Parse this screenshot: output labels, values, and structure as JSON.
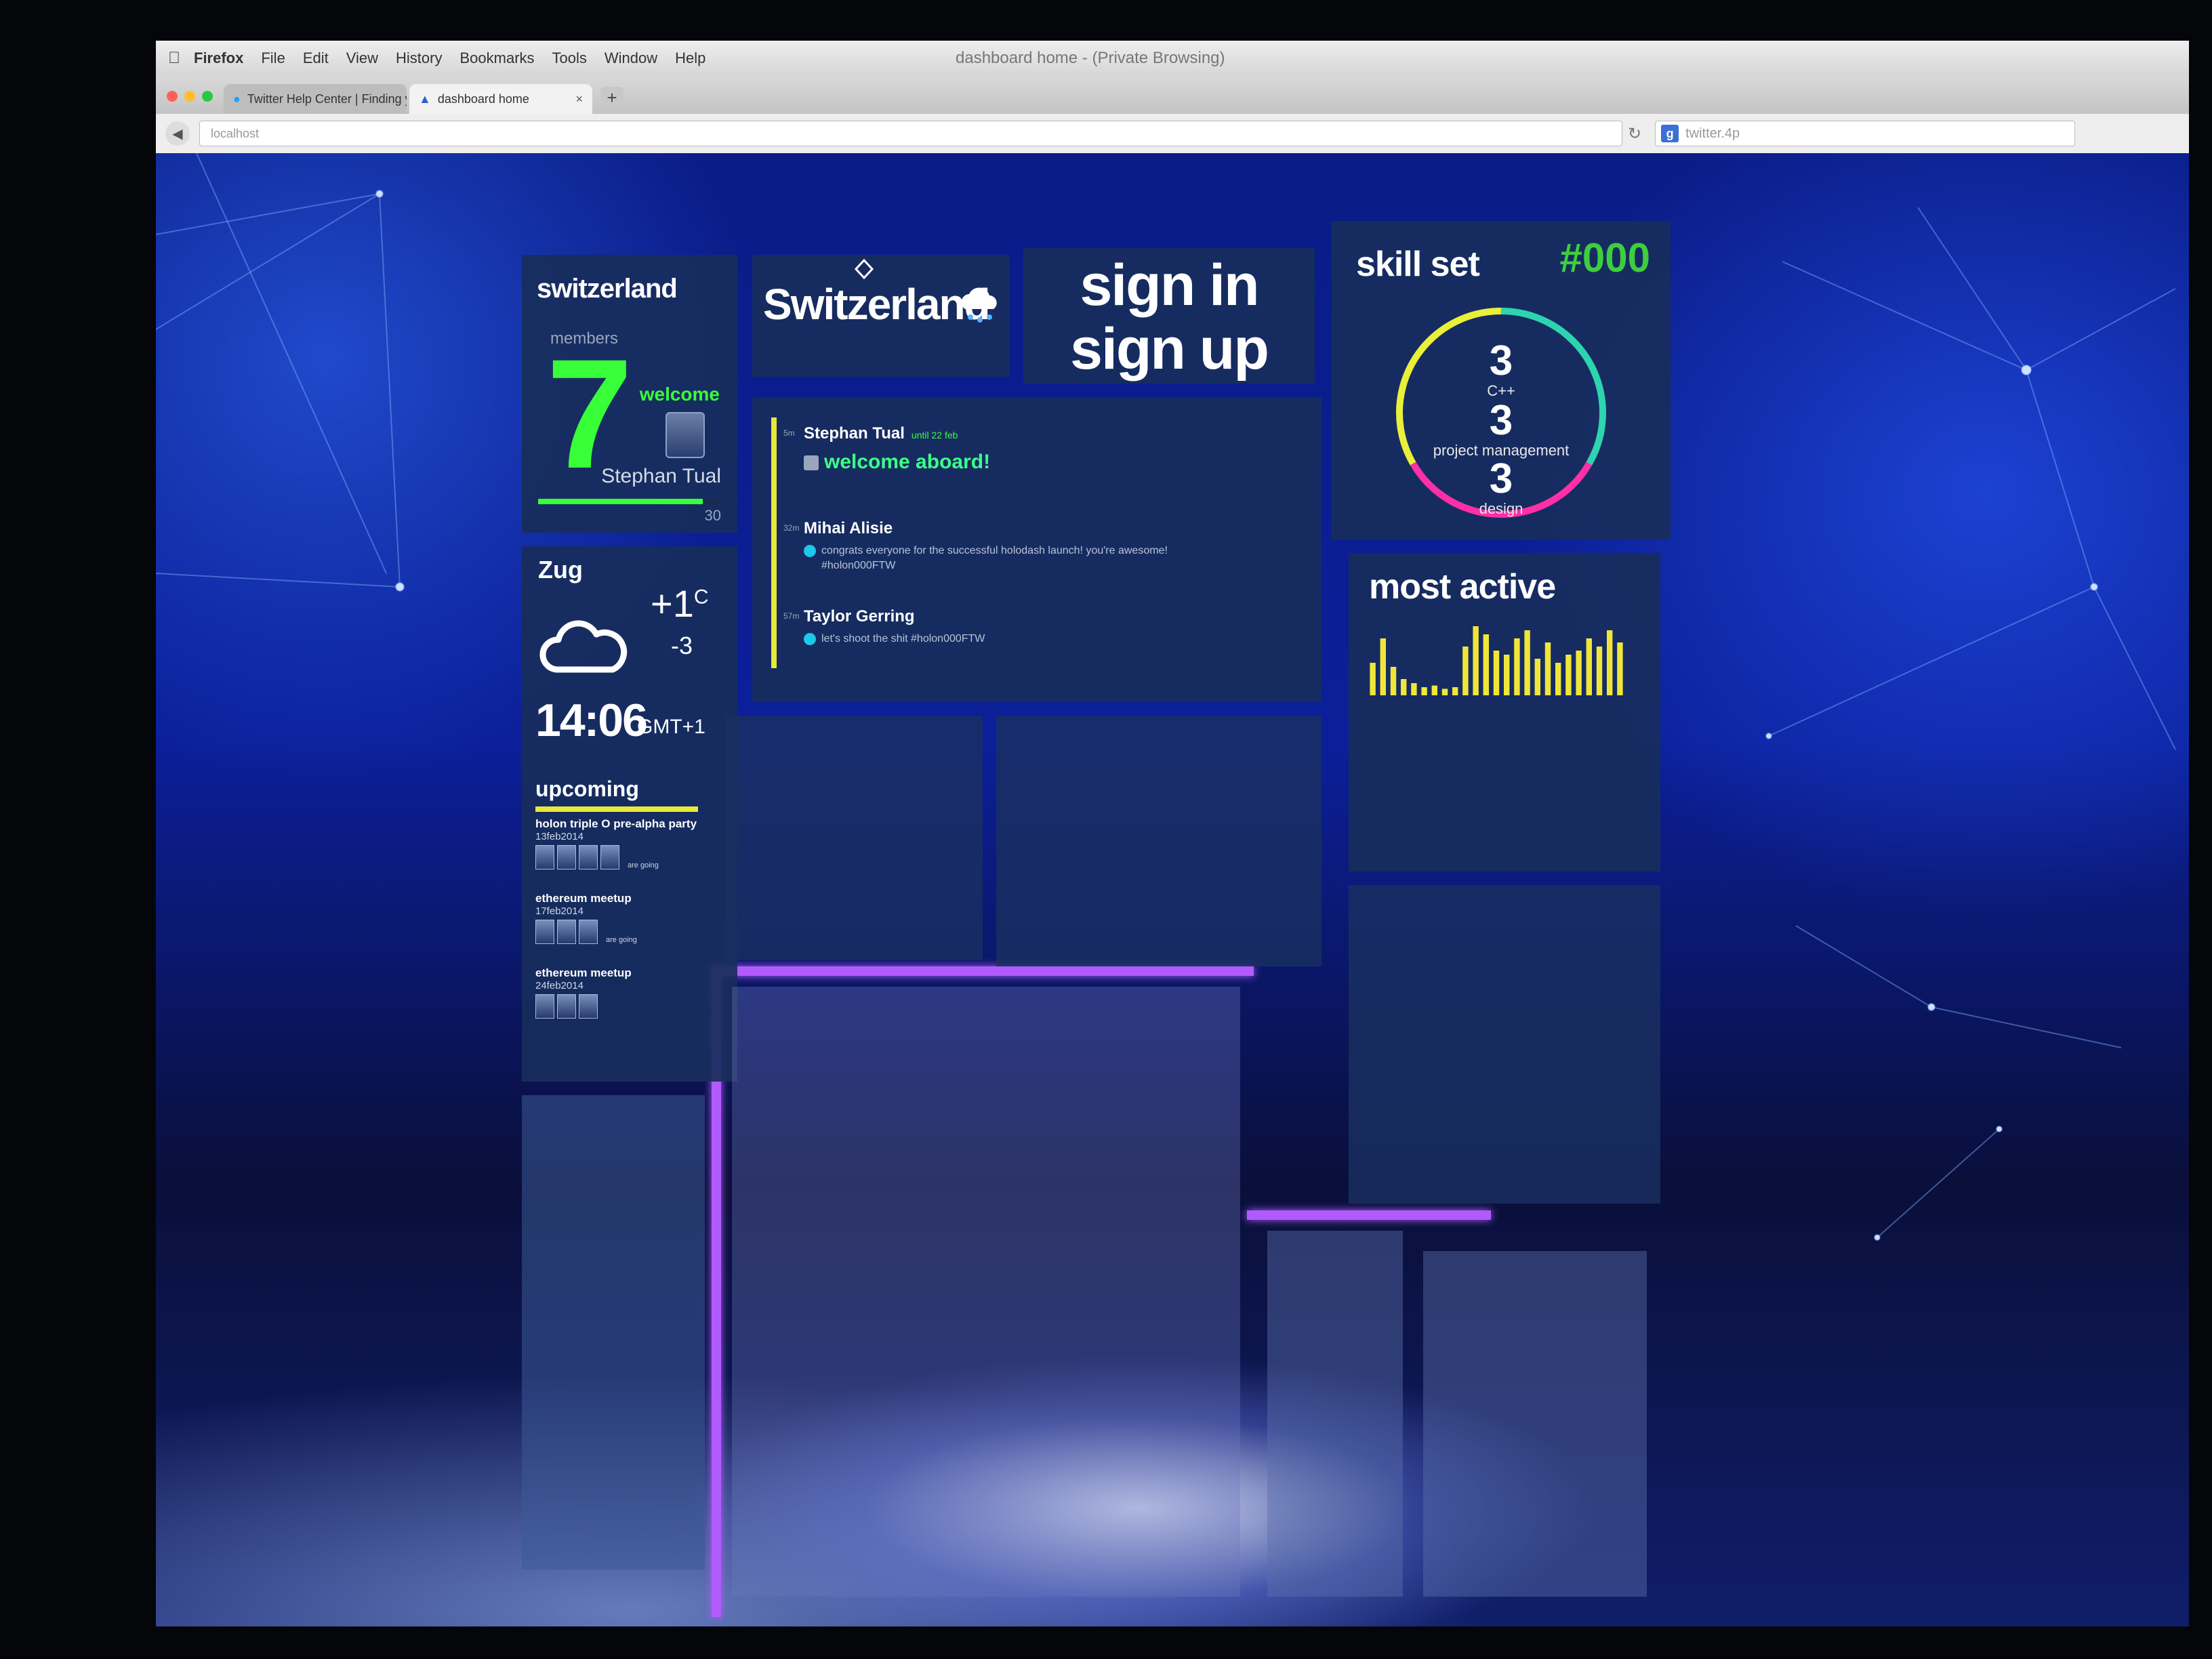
{
  "menubar": {
    "app": "Firefox",
    "items": [
      "File",
      "Edit",
      "View",
      "History",
      "Bookmarks",
      "Tools",
      "Window",
      "Help"
    ],
    "window_title": "dashboard home - (Private Browsing)"
  },
  "tabs": [
    {
      "label": "Twitter Help Center | Finding y...",
      "active": false
    },
    {
      "label": "dashboard home",
      "active": true
    }
  ],
  "navbar": {
    "url": "localhost",
    "search_placeholder": "twitter.4p"
  },
  "members_tile": {
    "title": "switzerland",
    "members_label": "members",
    "members_count": "7",
    "welcome_label": "welcome",
    "member_name": "Stephan Tual",
    "progress_max": "30",
    "progress_fraction": 0.9
  },
  "brand_tile": {
    "name": "Switzerland"
  },
  "auth_tile": {
    "sign_in": "sign in",
    "sign_up": "sign up"
  },
  "skill_tile": {
    "title": "skill set",
    "tag": "#000",
    "skills": [
      {
        "count": "3",
        "label": "C++",
        "color": "#2ed3b0"
      },
      {
        "count": "3",
        "label": "project management",
        "color": "#ff2fa8"
      },
      {
        "count": "3",
        "label": "design",
        "color": "#e8f03a"
      }
    ]
  },
  "feed": [
    {
      "time": "5m",
      "author": "Stephan Tual",
      "meta": "until 22 feb",
      "message": "welcome aboard!",
      "big": true
    },
    {
      "time": "32m",
      "author": "Mihai Alisie",
      "meta": "",
      "message": "congrats everyone for the successful holodash launch! you're awesome! #holon000FTW",
      "big": false
    },
    {
      "time": "57m",
      "author": "Taylor Gerring",
      "meta": "",
      "message": "let's shoot the shit #holon000FTW",
      "big": false
    }
  ],
  "weather_tile": {
    "city": "Zug",
    "temp_high": "+1",
    "temp_unit": "C",
    "temp_low": "-3",
    "time": "14:06",
    "timezone": "GMT+1",
    "upcoming_label": "upcoming",
    "events": [
      {
        "name": "holon triple O pre-alpha party",
        "date": "13feb2014",
        "going": "are going",
        "attendees": 4
      },
      {
        "name": "ethereum meetup",
        "date": "17feb2014",
        "going": "are going",
        "attendees": 3
      },
      {
        "name": "ethereum meetup",
        "date": "24feb2014",
        "going": "",
        "attendees": 3
      }
    ]
  },
  "most_active_tile": {
    "title": "most active",
    "bar_color": "#f0e63a"
  },
  "chart_data": {
    "type": "bar",
    "title": "most active",
    "values": [
      40,
      70,
      35,
      20,
      15,
      10,
      12,
      8,
      10,
      60,
      85,
      75,
      55,
      50,
      70,
      80,
      45,
      65,
      40,
      50,
      55,
      70,
      60,
      80,
      65
    ],
    "ylim": [
      0,
      100
    ]
  }
}
